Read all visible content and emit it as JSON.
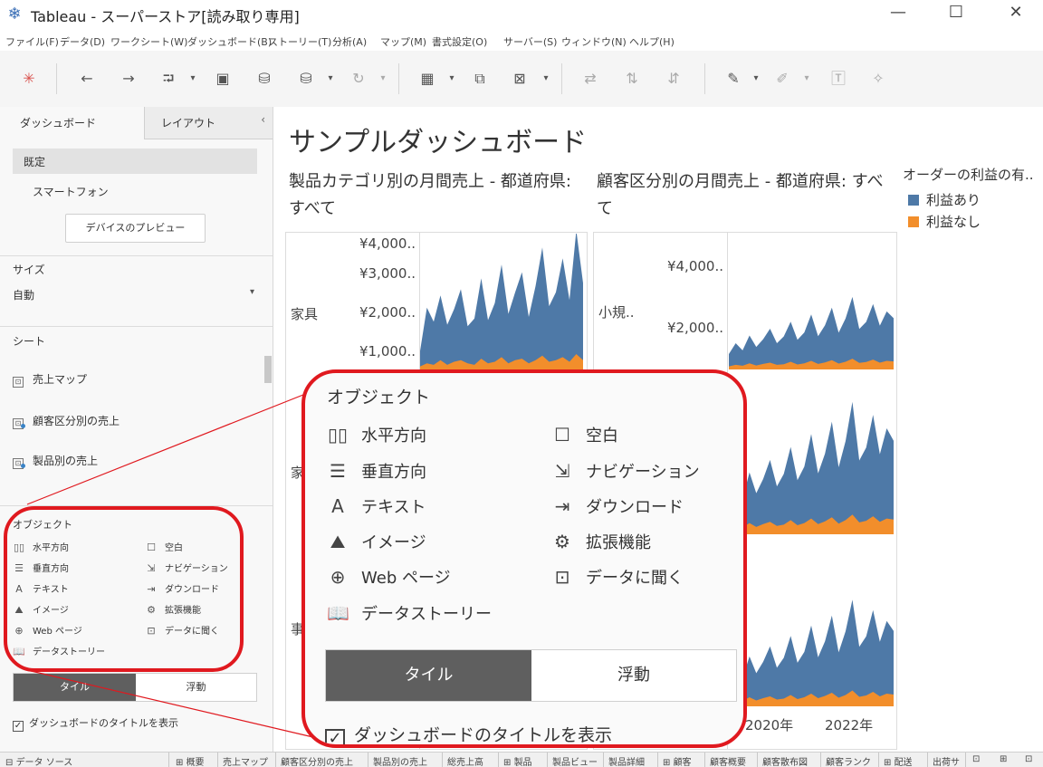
{
  "window": {
    "title": "Tableau - スーパーストア[読み取り専用]",
    "minimize": "—",
    "maximize": "☐",
    "close": "✕"
  },
  "menu": [
    "ファイル(F)",
    "データ(D)",
    "ワークシート(W)",
    "ダッシュボード(B)",
    "ストーリー(T)",
    "分析(A)",
    "マップ(M)",
    "書式設定(O)",
    "サーバー(S)",
    "ウィンドウ(N)",
    "ヘルプ(H)"
  ],
  "toolbar": {
    "icons": [
      "tableau-logo-icon",
      "back-icon",
      "forward-icon",
      "redo-icon",
      "save-icon",
      "new-datasource-icon",
      "pause-icon",
      "refresh-icon",
      "new-worksheet-icon",
      "duplicate-icon",
      "clear-icon",
      "swap-icon",
      "sort-asc-icon",
      "sort-desc-icon",
      "highlight-icon",
      "annotate-icon",
      "label-icon",
      "pin-icon"
    ]
  },
  "left_panel": {
    "tab_dashboard": "ダッシュボード",
    "tab_layout": "レイアウト",
    "collapse": "‹",
    "device_default": "既定",
    "device_phone": "スマートフォン",
    "preview_button": "デバイスのプレビュー",
    "size_header": "サイズ",
    "size_value": "自動",
    "sheets_header": "シート",
    "sheets": [
      "売上マップ",
      "顧客区分別の売上",
      "製品別の売上"
    ],
    "objects_header": "オブジェクト",
    "objects": [
      {
        "label": "水平方向",
        "icon": "horizontal-container-icon"
      },
      {
        "label": "空白",
        "icon": "blank-icon"
      },
      {
        "label": "垂直方向",
        "icon": "vertical-container-icon"
      },
      {
        "label": "ナビゲーション",
        "icon": "navigation-icon"
      },
      {
        "label": "テキスト",
        "icon": "text-icon"
      },
      {
        "label": "ダウンロード",
        "icon": "download-icon"
      },
      {
        "label": "イメージ",
        "icon": "image-icon"
      },
      {
        "label": "拡張機能",
        "icon": "extension-icon"
      },
      {
        "label": "Web ページ",
        "icon": "web-page-icon"
      },
      {
        "label": "データに聞く",
        "icon": "ask-data-icon"
      },
      {
        "label": "データストーリー",
        "icon": "data-story-icon"
      }
    ],
    "tile": "タイル",
    "floating": "浮動",
    "show_title": "ダッシュボードのタイトルを表示"
  },
  "dashboard": {
    "title": "サンプルダッシュボード",
    "chart1_title": "製品カテゴリ別の月間売上 - 都道府県: すべて",
    "chart2_title": "顧客区分別の月間売上 - 都道府県: すべて",
    "legend_title": "オーダーの利益の有..",
    "legend": [
      {
        "label": "利益あり",
        "color": "#4e79a7"
      },
      {
        "label": "利益なし",
        "color": "#f28e2b"
      }
    ],
    "chart1_ticks": [
      "¥4,000..",
      "¥3,000..",
      "¥2,000..",
      "¥1,000.."
    ],
    "chart1_row1": "家具",
    "chart1_row2": "家",
    "chart2_ticks": [
      "¥4,000..",
      "¥2,000.."
    ],
    "chart2_row1": "小規..",
    "chart2_row3": "事",
    "x_ticks": [
      "2020年",
      "2022年"
    ]
  },
  "chart_data": [
    {
      "type": "area",
      "title": "製品カテゴリ別の月間売上 - 都道府県: すべて",
      "row": "家具",
      "y_ticks": [
        "¥4,000..",
        "¥3,000..",
        "¥2,000..",
        "¥1,000.."
      ],
      "series": [
        {
          "name": "利益あり",
          "values": [
            500,
            1800,
            1400,
            2100,
            1300,
            1700,
            2300,
            1200,
            1500,
            2600,
            1400,
            1900,
            3000,
            1600,
            2200,
            2800,
            1500,
            2400,
            3500,
            1800,
            2200,
            3200,
            2000,
            4000,
            2500
          ]
        },
        {
          "name": "利益なし",
          "values": [
            100,
            200,
            150,
            300,
            150,
            250,
            300,
            200,
            150,
            350,
            200,
            250,
            400,
            200,
            300,
            350,
            200,
            300,
            450,
            250,
            300,
            400,
            250,
            500,
            300
          ]
        }
      ]
    },
    {
      "type": "area",
      "title": "顧客区分別の月間売上 - 都道府県: すべて",
      "row": "小規..",
      "y_ticks": [
        "¥4,000..",
        "¥2,000.."
      ],
      "x_ticks": [
        "2020年",
        "2022年"
      ],
      "series": [
        {
          "name": "利益あり",
          "values": [
            400,
            700,
            500,
            900,
            600,
            800,
            1100,
            700,
            900,
            1300,
            800,
            1000,
            1500,
            900,
            1200,
            1700,
            1000,
            1400,
            2000,
            1100,
            1300,
            1800,
            1200,
            1600,
            1400
          ]
        },
        {
          "name": "利益なし",
          "values": [
            100,
            150,
            120,
            200,
            130,
            180,
            220,
            150,
            170,
            250,
            160,
            200,
            280,
            180,
            230,
            300,
            190,
            250,
            350,
            210,
            240,
            320,
            220,
            280,
            260
          ]
        }
      ]
    }
  ],
  "status_bar": {
    "datasource": "データ ソース",
    "tabs": [
      "概要",
      "売上マップ",
      "顧客区分別の売上",
      "製品別の売上",
      "総売上高",
      "製品",
      "製品ビュー",
      "製品詳細",
      "顧客",
      "顧客概要",
      "顧客散布図",
      "顧客ランク",
      "配送",
      "出荷サ"
    ]
  }
}
